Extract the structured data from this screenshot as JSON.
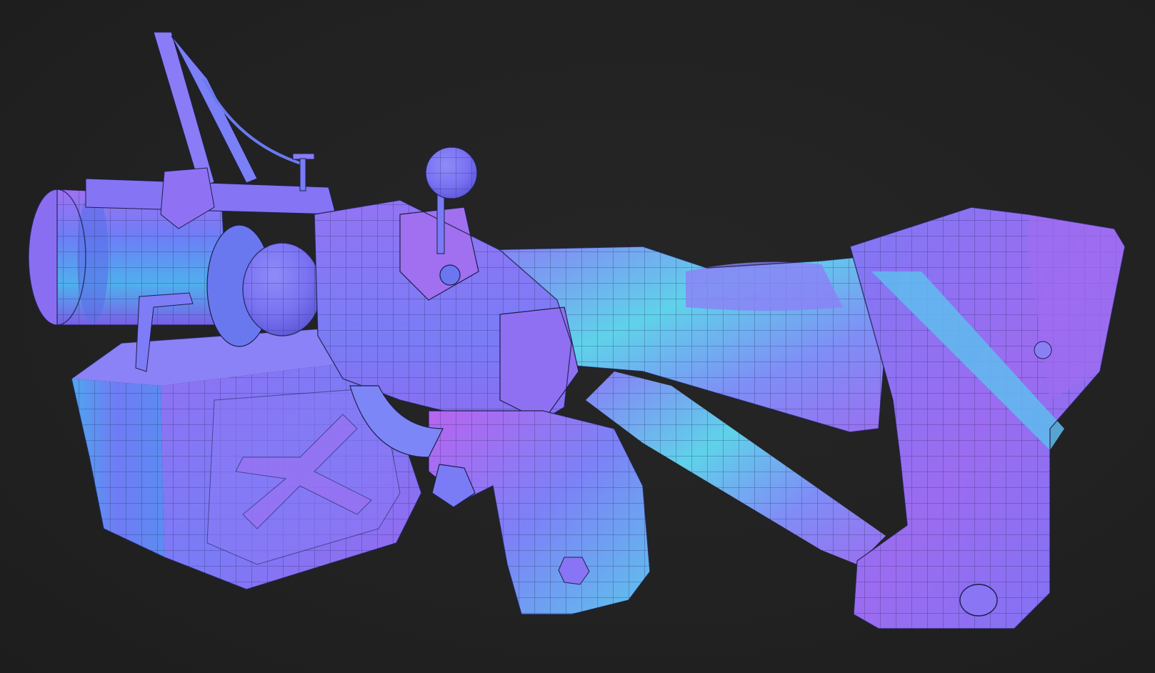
{
  "scene": {
    "subject": "wireframe-normal-map-blaster-model",
    "background_color": "#202020",
    "palette": {
      "normal_blue": "#7a7cf6",
      "normal_violet": "#a06cf0",
      "normal_magenta": "#c65ef0",
      "normal_cyan": "#5fd6e8",
      "normal_teal": "#4fe3c6",
      "normal_deep": "#5a57d8",
      "wire_color": "#23285a"
    }
  }
}
